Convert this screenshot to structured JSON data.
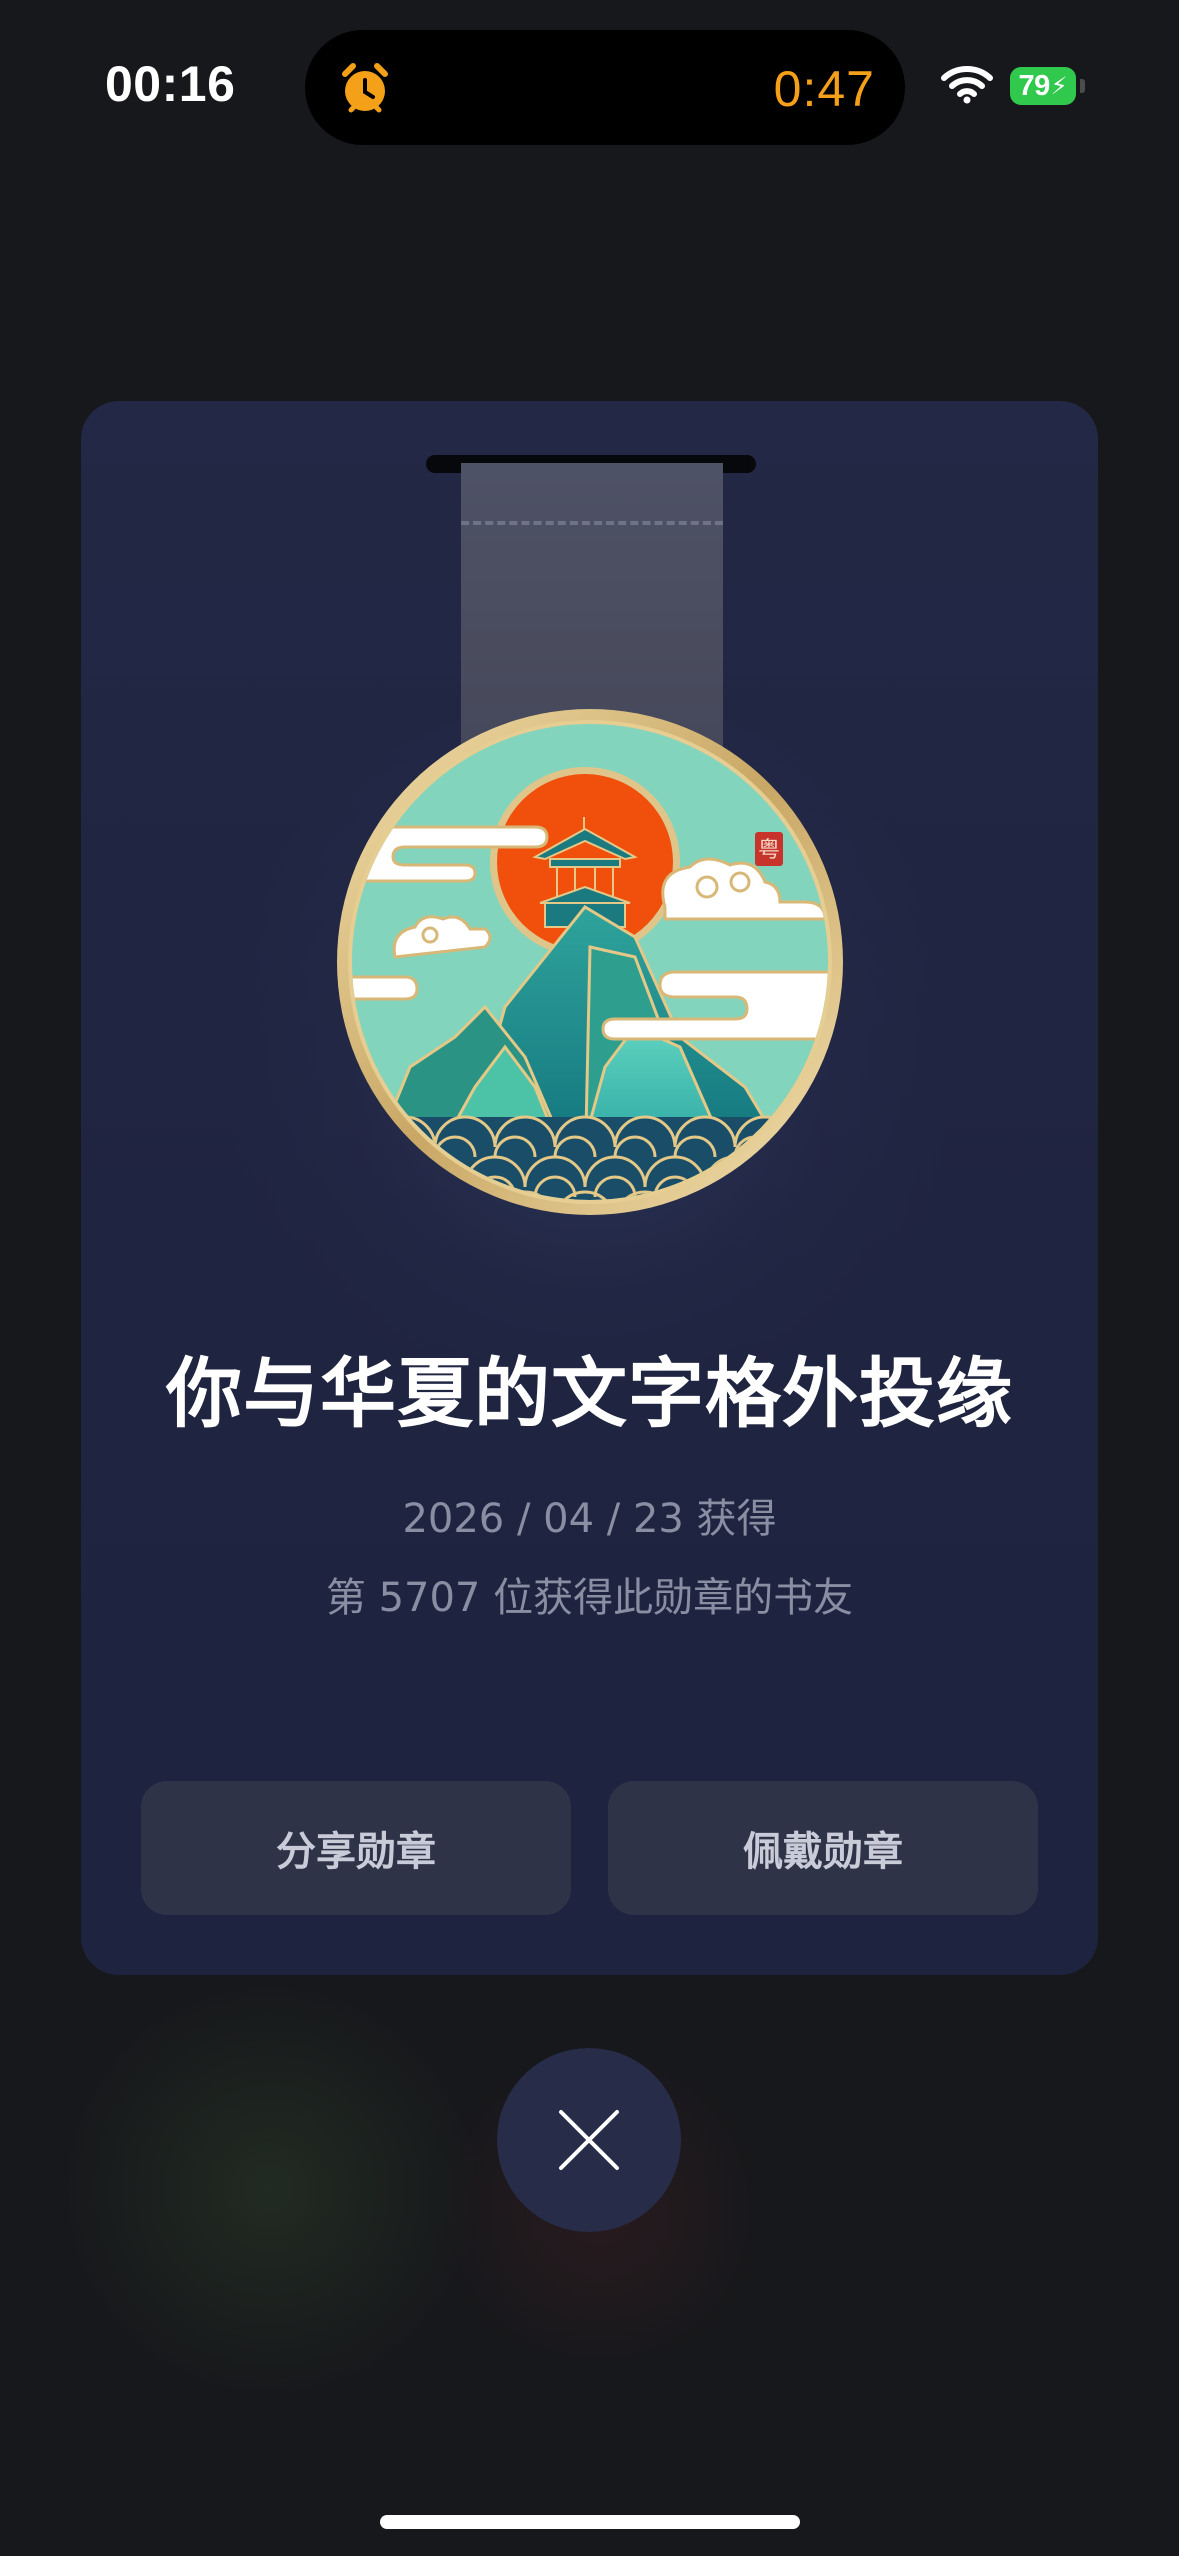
{
  "status_bar": {
    "time": "00:16",
    "timer": "0:47",
    "battery": "79",
    "alarm_icon": "alarm-clock-icon",
    "wifi_icon": "wifi-icon"
  },
  "badge": {
    "title": "你与华夏的文字格外投缘",
    "date": "2026 / 04 / 23 获得",
    "rank": "第 5707 位获得此勋章的书友",
    "seal_text": "粤"
  },
  "actions": {
    "share_label": "分享勋章",
    "wear_label": "佩戴勋章"
  },
  "colors": {
    "card_bg": "#222845",
    "button_bg": "#2e3348",
    "timer_orange": "#f5a019",
    "battery_green": "#30c84d",
    "medal_teal": "#7fd1b9",
    "medal_sun": "#f04f0c",
    "medal_gold": "#d9bd7e"
  }
}
